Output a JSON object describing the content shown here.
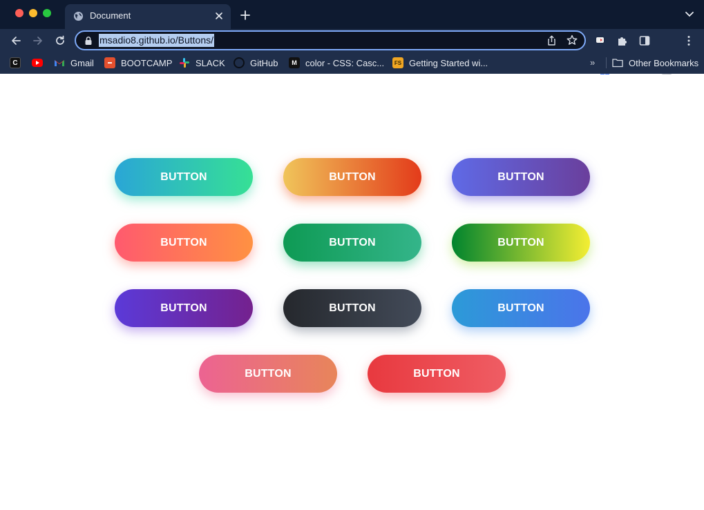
{
  "browser": {
    "tab_title": "Document",
    "url": "msadio8.github.io/Buttons/",
    "extension_badge": "1",
    "bookmarks": [
      {
        "label": "",
        "icon": "c-logo-icon"
      },
      {
        "label": "",
        "icon": "youtube-icon"
      },
      {
        "label": "Gmail",
        "icon": "gmail-icon"
      },
      {
        "label": "BOOTCAMP",
        "icon": "bootcamp-icon"
      },
      {
        "label": "SLACK",
        "icon": "slack-icon"
      },
      {
        "label": "GitHub",
        "icon": "github-icon"
      },
      {
        "label": "color - CSS: Casc...",
        "icon": "mdn-icon"
      },
      {
        "label": "Getting Started wi...",
        "icon": "fs-icon"
      }
    ],
    "overflow_label": "»",
    "other_bookmarks": "Other Bookmarks"
  },
  "page": {
    "buttons": [
      {
        "label": "BUTTON",
        "gradient": [
          "#2aa6d6",
          "#36e095"
        ],
        "glow": "#5fe0b9"
      },
      {
        "label": "BUTTON",
        "gradient": [
          "#f0c45a",
          "#e33b1a"
        ],
        "glow": "#f5794f"
      },
      {
        "label": "BUTTON",
        "gradient": [
          "#5f6ae6",
          "#6a3f9c"
        ],
        "glow": "#8a7fe0"
      },
      {
        "label": "BUTTON",
        "gradient": [
          "#ff5a6e",
          "#ff9142"
        ],
        "glow": "#ff8a80"
      },
      {
        "label": "BUTTON",
        "gradient": [
          "#0e9a54",
          "#34b58a"
        ],
        "glow": "#5ccf9c"
      },
      {
        "label": "BUTTON",
        "gradient": [
          "#00842e",
          "#f4ee33"
        ],
        "glow": "#b6e66a"
      },
      {
        "label": "BUTTON",
        "gradient": [
          "#5b3ad8",
          "#74218e"
        ],
        "glow": "#a07ae6"
      },
      {
        "label": "BUTTON",
        "gradient": [
          "#25282d",
          "#434b59"
        ],
        "glow": "#7e8796"
      },
      {
        "label": "BUTTON",
        "gradient": [
          "#2c9ad8",
          "#4b74ea"
        ],
        "glow": "#7fb0f2"
      },
      {
        "label": "BUTTON",
        "gradient": [
          "#ec6392",
          "#e8855a"
        ],
        "glow": "#f59ab3"
      },
      {
        "label": "BUTTON",
        "gradient": [
          "#e8393f",
          "#ef5d64"
        ],
        "glow": "#f58a8f"
      }
    ]
  }
}
